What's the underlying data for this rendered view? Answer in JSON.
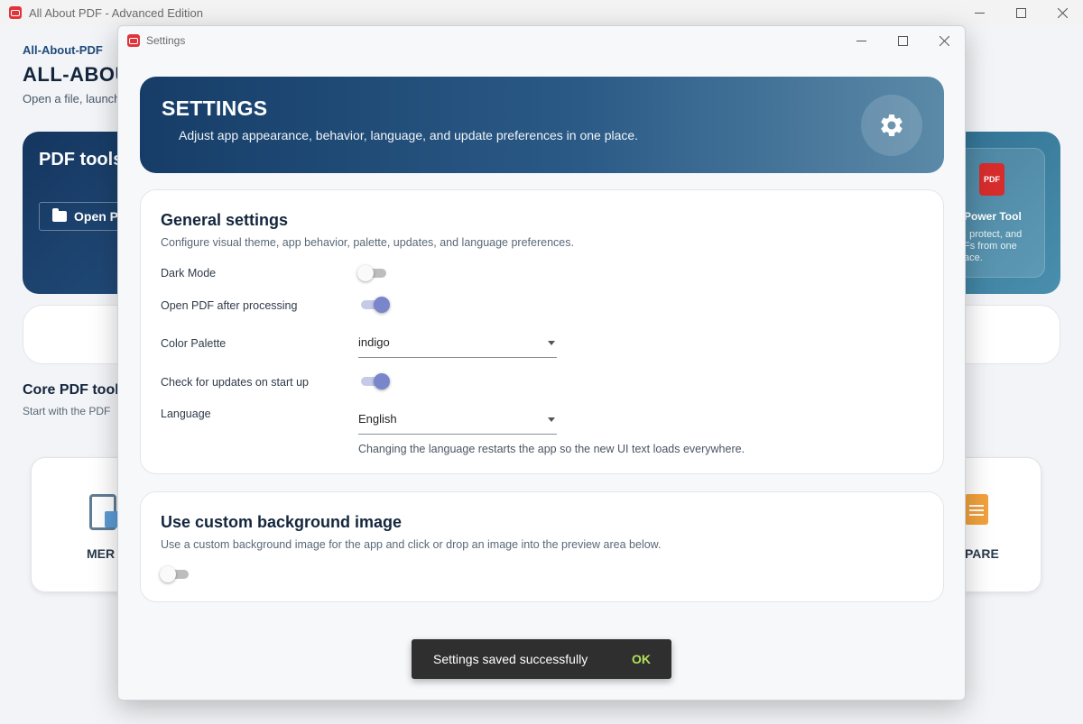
{
  "main": {
    "window_title": "All About PDF - Advanced Edition",
    "brand_small": "All-About-PDF",
    "brand_big": "ALL-ABOU",
    "brand_sub": "Open a file, launch",
    "hero_left_title": "PDF tools",
    "open_button": "Open P",
    "hero_right_badge": "PDF",
    "hero_right_title": "Power Tool",
    "hero_right_text": ", protect, and\nFs from one\nace.",
    "core_title": "Core PDF tool",
    "core_sub": "Start with the PDF",
    "tool_left_label": "MER",
    "tool_right_label": "PARE"
  },
  "dialog": {
    "title": "Settings",
    "banner_title": "SETTINGS",
    "banner_subtitle": "Adjust app appearance, behavior, language, and update preferences in one place.",
    "general": {
      "title": "General settings",
      "subtitle": "Configure visual theme, app behavior, palette, updates, and language preferences.",
      "dark_mode_label": "Dark Mode",
      "dark_mode_on": false,
      "open_pdf_label": "Open PDF after processing",
      "open_pdf_on": true,
      "palette_label": "Color Palette",
      "palette_value": "indigo",
      "updates_label": "Check for updates on start up",
      "updates_on": true,
      "language_label": "Language",
      "language_value": "English",
      "language_helper": "Changing the language restarts the app so the new UI text loads everywhere."
    },
    "background": {
      "title": "Use custom background image",
      "subtitle": "Use a custom background image for the app and click or drop an image into the preview area below.",
      "enabled": false
    },
    "snackbar": {
      "message": "Settings saved successfully",
      "action": "OK"
    }
  },
  "colors": {
    "accent": "#7986cb",
    "banner_dark": "#163d68",
    "banner_light": "#5b8aa8",
    "snackbar_action": "#b2e05a"
  }
}
